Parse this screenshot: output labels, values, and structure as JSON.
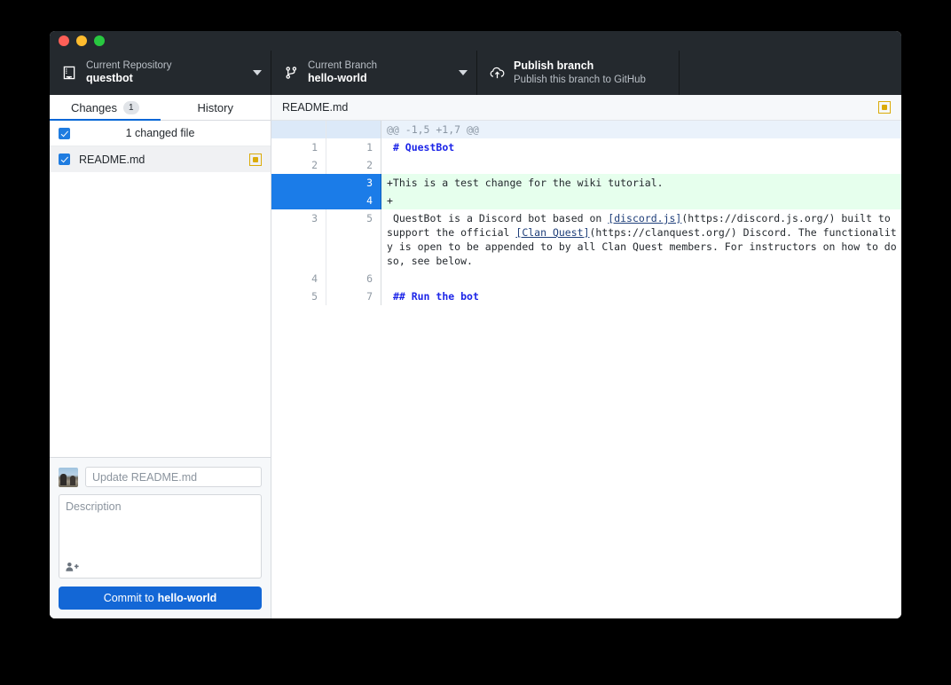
{
  "window": {
    "traffic_lights": [
      "close",
      "minimize",
      "maximize"
    ]
  },
  "toolbar": {
    "repository": {
      "icon": "repo-icon",
      "label": "Current Repository",
      "value": "questbot",
      "caret": "chevron-down-icon"
    },
    "branch": {
      "icon": "git-branch-icon",
      "label": "Current Branch",
      "value": "hello-world",
      "caret": "chevron-down-icon"
    },
    "publish": {
      "icon": "cloud-upload-icon",
      "title": "Publish branch",
      "subtitle": "Publish this branch to GitHub"
    }
  },
  "sidebar": {
    "tabs": [
      {
        "label": "Changes",
        "badge": "1",
        "active": true
      },
      {
        "label": "History",
        "badge": "",
        "active": false
      }
    ],
    "changed_files_summary": "1 changed file",
    "files": [
      {
        "name": "README.md",
        "status": "modified",
        "checked": true
      }
    ],
    "commit": {
      "summary_placeholder": "Update README.md",
      "summary_value": "",
      "description_placeholder": "Description",
      "description_value": "",
      "coauthor_icon": "add-coauthor-icon",
      "button_prefix": "Commit to",
      "button_branch": "hello-world"
    }
  },
  "diff": {
    "filename": "README.md",
    "status": "modified",
    "hunk_header": "@@ -1,5 +1,7 @@",
    "lines": [
      {
        "old": "1",
        "new": "1",
        "type": "context",
        "text": " # QuestBot",
        "style": "heading"
      },
      {
        "old": "2",
        "new": "2",
        "type": "context",
        "text": "",
        "style": "plain"
      },
      {
        "old": "",
        "new": "3",
        "type": "added",
        "text": "+This is a test change for the wiki tutorial.",
        "style": "plain"
      },
      {
        "old": "",
        "new": "4",
        "type": "added",
        "text": "+",
        "style": "plain"
      },
      {
        "old": "3",
        "new": "5",
        "type": "context",
        "text": " QuestBot is a Discord bot based on [discord.js](https://discord.js.org/) built to support the official [Clan Quest](https://clanquest.org/) Discord. The functionality is open to be appended to by all Clan Quest members. For instructors on how to do so, see below.",
        "style": "body"
      },
      {
        "old": "4",
        "new": "6",
        "type": "context",
        "text": "",
        "style": "plain"
      },
      {
        "old": "5",
        "new": "7",
        "type": "context",
        "text": " ## Run the bot",
        "style": "heading"
      }
    ]
  },
  "colors": {
    "toolbar_bg": "#24292e",
    "accent_blue": "#0366d6",
    "commit_button": "#1367d6",
    "added_bg": "#e6ffed",
    "selected_gutter": "#1b7ce8",
    "modified_status": "#dbab09"
  }
}
